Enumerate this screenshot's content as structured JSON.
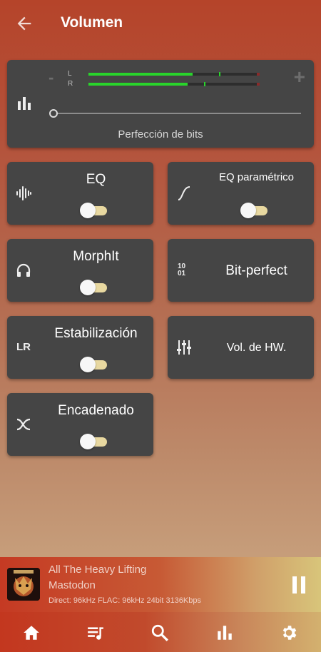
{
  "header": {
    "title": "Volumen"
  },
  "volume_card": {
    "minus_label": "-",
    "plus_label": "+",
    "channel_left": "L",
    "channel_right": "R",
    "left_level": 0.62,
    "right_level": 0.59,
    "caption": "Perfección de bits"
  },
  "tiles": {
    "eq": {
      "label": "EQ",
      "enabled": false
    },
    "parametric_eq": {
      "label": "EQ paramétrico",
      "enabled": false
    },
    "morphit": {
      "label": "MorphIt",
      "enabled": false
    },
    "bit_perfect": {
      "label": "Bit-perfect",
      "icon_text": "10\n01"
    },
    "stabilization": {
      "label": "Estabilización",
      "enabled": false,
      "icon_text": "LR"
    },
    "hw_volume": {
      "label": "Vol. de HW."
    },
    "chained": {
      "label": "Encadenado",
      "enabled": false
    }
  },
  "player": {
    "song": "All The Heavy Lifting",
    "artist": "Mastodon",
    "info": "Direct: 96kHz  FLAC: 96kHz  24bit   3136Kbps"
  },
  "nav": [
    "home-icon",
    "playlist-icon",
    "search-icon",
    "chart-icon",
    "settings-icon"
  ],
  "colors": {
    "card": "#454545",
    "meter_green": "#29d42b",
    "toggle_track": "#e8d8a0"
  }
}
